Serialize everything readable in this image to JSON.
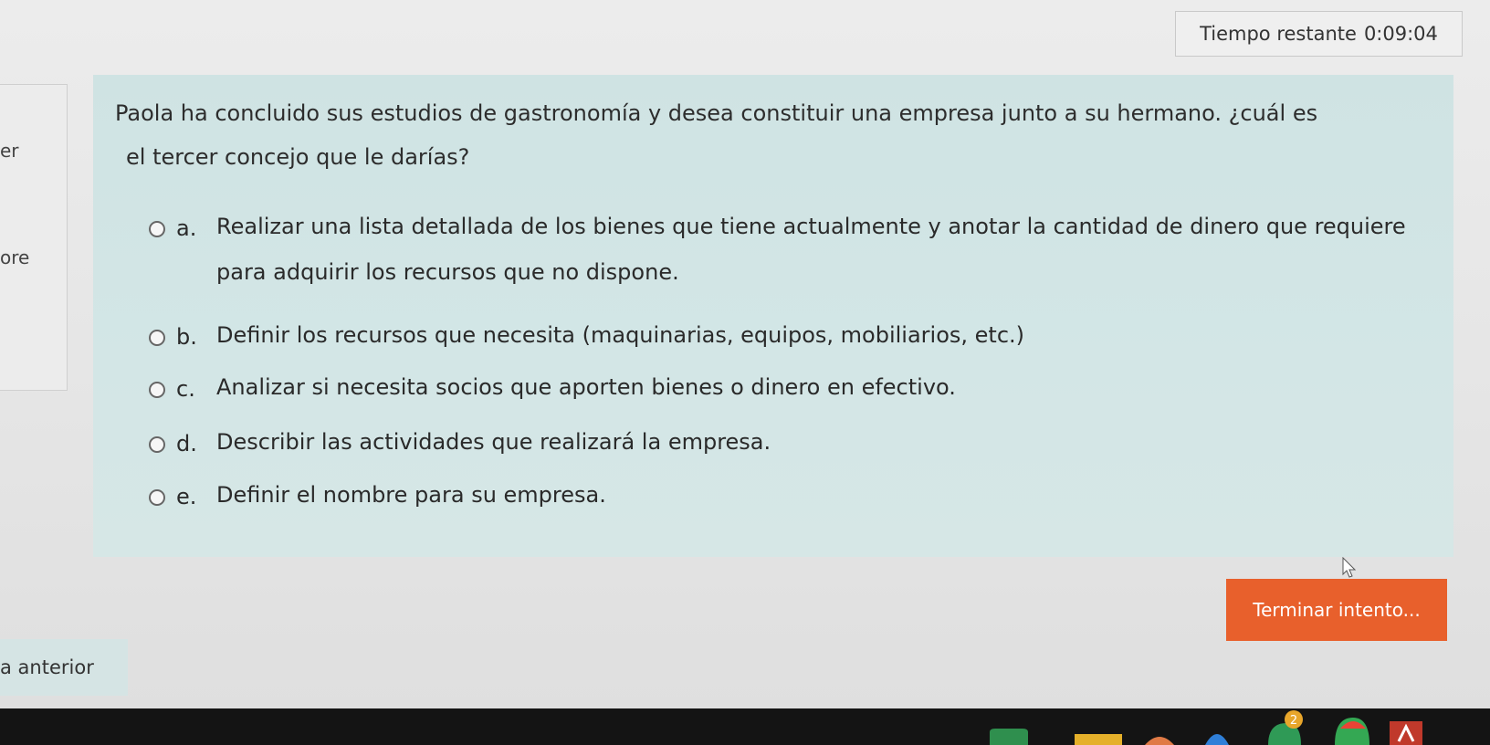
{
  "timer": {
    "label": "Tiempo restante",
    "value": "0:09:04"
  },
  "sidebar": {
    "fragment_1": "er",
    "fragment_2": "ore"
  },
  "question": {
    "text_line1": "Paola ha concluido sus estudios de gastronomía y desea constituir una empresa junto a su hermano. ¿cuál es",
    "text_line2": "el tercer concejo que le darías?",
    "options": [
      {
        "letter": "a.",
        "text": "Realizar una lista detallada de los bienes que tiene actualmente y anotar la cantidad de dinero que requiere para adquirir los recursos que no dispone."
      },
      {
        "letter": "b.",
        "text": "Definir los recursos que necesita (maquinarias, equipos, mobiliarios, etc.)"
      },
      {
        "letter": "c.",
        "text": "Analizar si necesita socios que aporten bienes o dinero en efectivo."
      },
      {
        "letter": "d.",
        "text": "Describir las actividades que realizará la empresa."
      },
      {
        "letter": "e.",
        "text": "Definir el nombre para su empresa."
      }
    ]
  },
  "actions": {
    "finish_label": "Terminar intento...",
    "prev_label": "a anterior"
  },
  "colors": {
    "accent": "#e8602c",
    "question_bg": "#d3e6e6",
    "taskbar": "#141414"
  },
  "taskbar": {
    "icons": [
      "folder-icon",
      "browser-icon",
      "app-icon",
      "badge-app-icon",
      "chrome-icon",
      "app-icon"
    ],
    "badge_count": "2"
  }
}
